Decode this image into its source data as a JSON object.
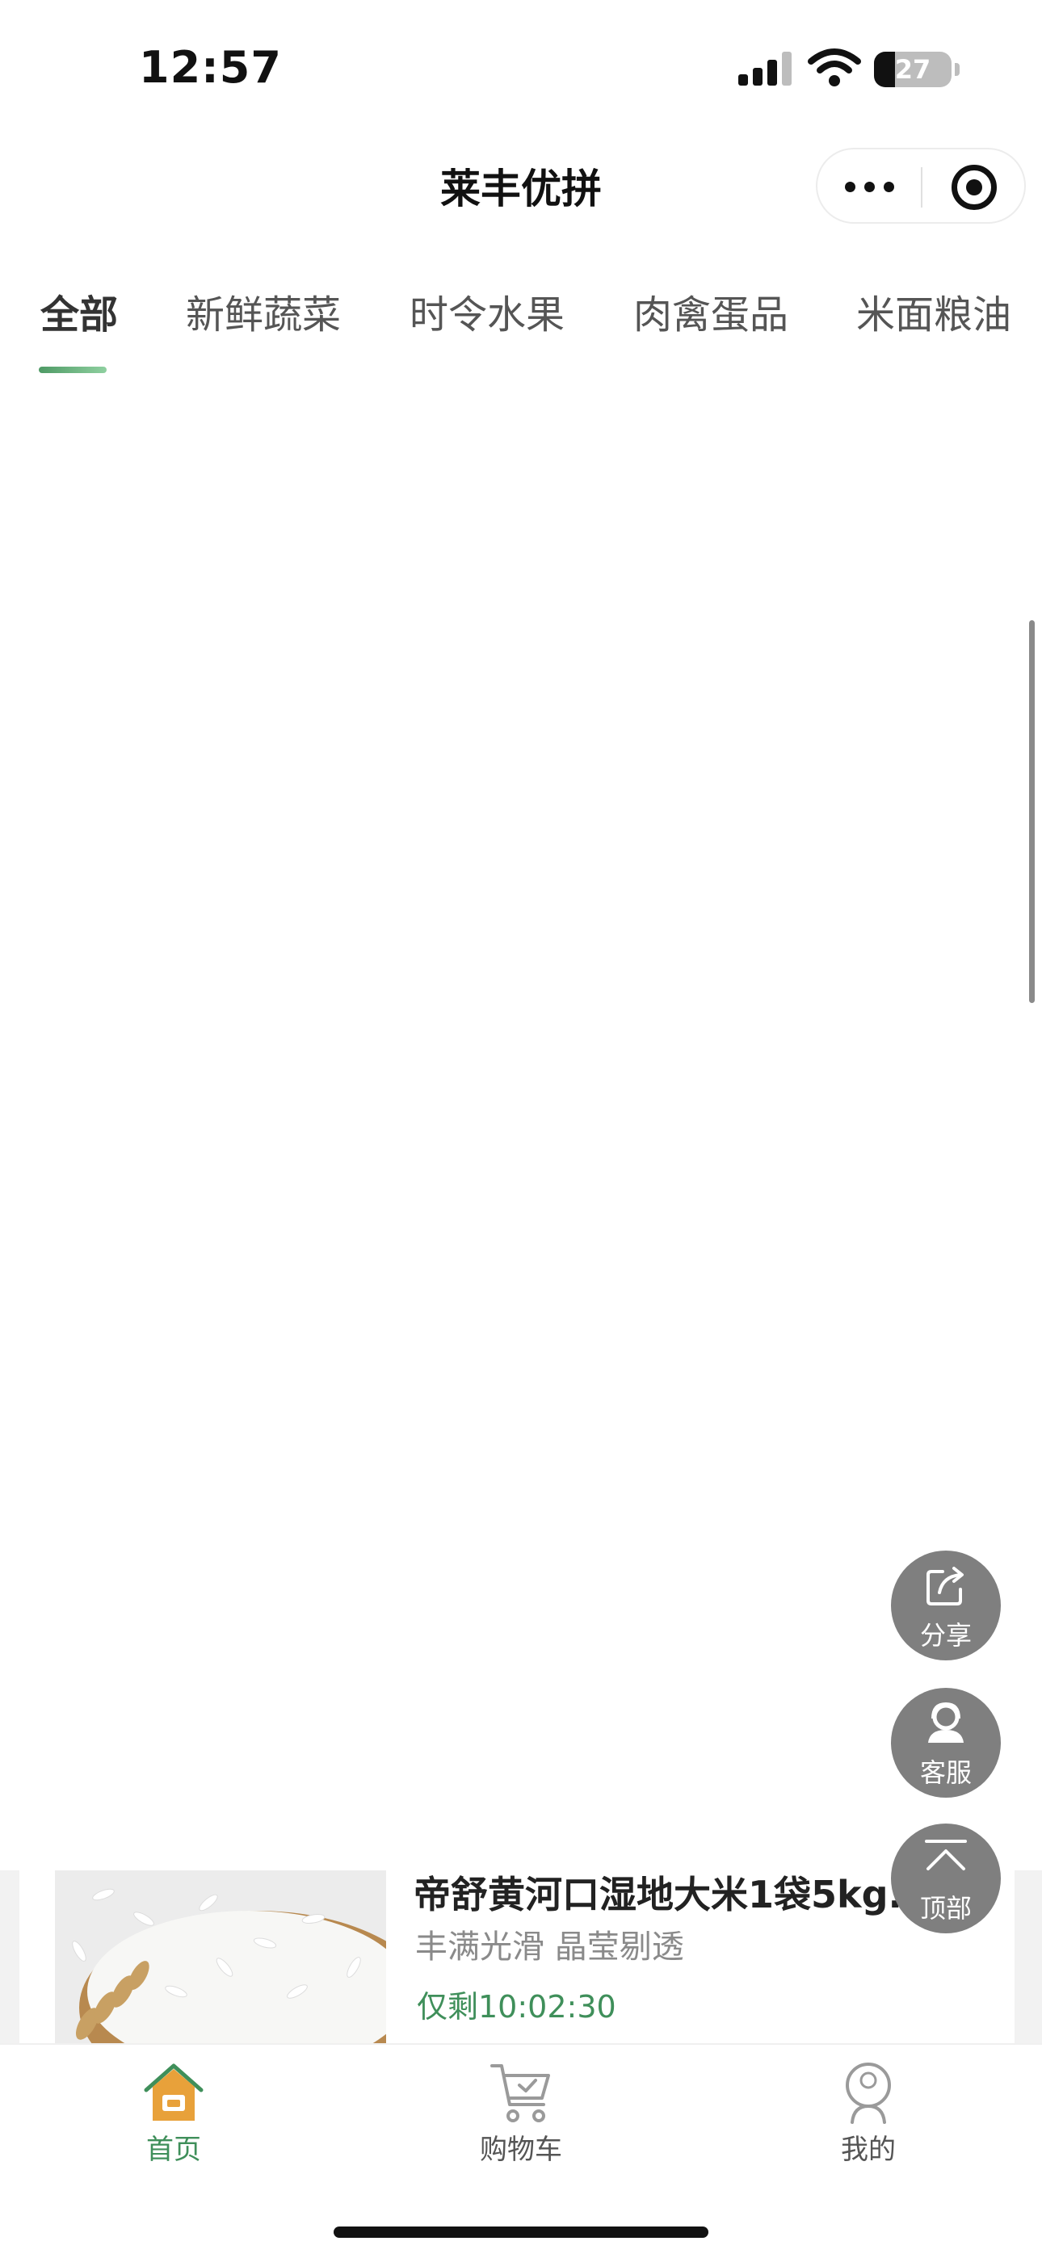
{
  "status_bar": {
    "time": "12:57",
    "battery_level": "27",
    "battery_fraction": 0.27,
    "icons": [
      "signal-icon",
      "wifi-icon",
      "battery-icon"
    ]
  },
  "header": {
    "title": "莱丰优拼",
    "capsule_icons": [
      "more-icon",
      "target-icon"
    ]
  },
  "tabs": [
    {
      "label": "全部",
      "active": true
    },
    {
      "label": "新鲜蔬菜",
      "active": false
    },
    {
      "label": "时令水果",
      "active": false
    },
    {
      "label": "肉禽蛋品",
      "active": false
    },
    {
      "label": "米面粮油",
      "active": false
    }
  ],
  "floating_actions": [
    {
      "label": "分享",
      "icon": "share-icon"
    },
    {
      "label": "客服",
      "icon": "customer-service-icon"
    },
    {
      "label": "顶部",
      "icon": "back-to-top-icon"
    }
  ],
  "product": {
    "name": "帝舒黄河口湿地大米1袋5kg...",
    "desc": "丰满光滑  晶莹剔透",
    "timer": "仅剩10:02:30",
    "image": "rice-product-image"
  },
  "tabbar": [
    {
      "label": "首页",
      "icon": "home-icon",
      "active": true
    },
    {
      "label": "购物车",
      "icon": "cart-icon",
      "active": false
    },
    {
      "label": "我的",
      "icon": "profile-icon",
      "active": false
    }
  ],
  "colors": {
    "accent": "#3f8f5a",
    "fab": "#7f7f7f",
    "home_icon_orange": "#e8a13a"
  }
}
